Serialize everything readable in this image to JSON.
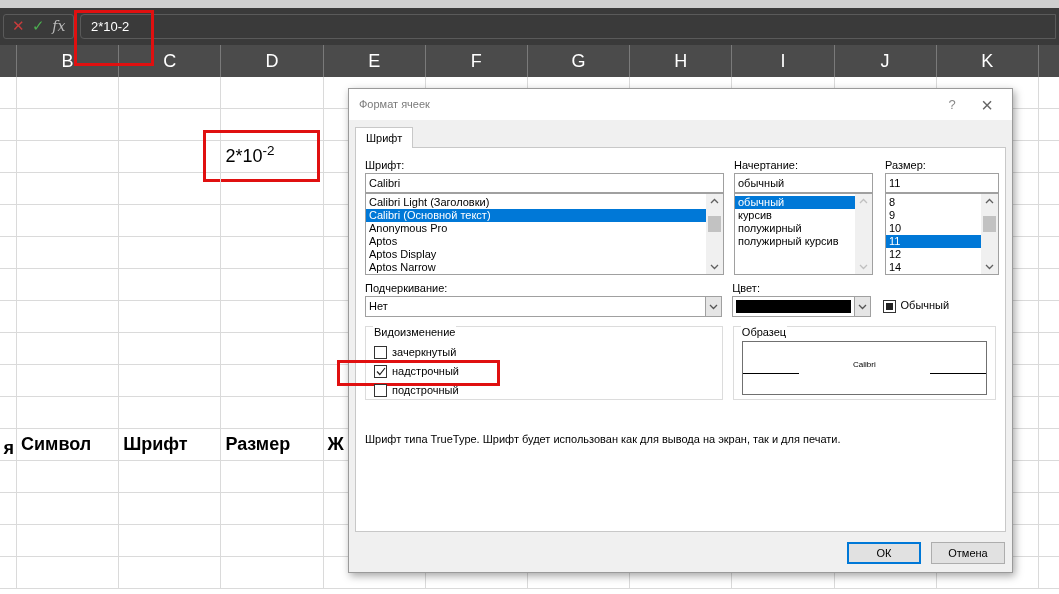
{
  "formula_bar": {
    "cancel": "✕",
    "enter": "✓",
    "function": "fx",
    "value": "2*10-2",
    "highlighted": true
  },
  "sheet": {
    "columns": [
      "B",
      "C",
      "D",
      "E",
      "F",
      "G",
      "H",
      "I",
      "J",
      "K"
    ],
    "value_cell": {
      "text": "2*10$^{-2}$",
      "highlighted": true
    },
    "header_row": [
      "я",
      "Символ",
      "Шрифт",
      "Размер",
      "Ж"
    ]
  },
  "dialog": {
    "title": "Формат ячеек",
    "help": "?",
    "close": "×",
    "tabs": [
      {
        "label": "Шрифт",
        "selected": true
      }
    ],
    "font": {
      "label": "Шрифт:",
      "value": "Calibri",
      "items": [
        {
          "label": "Calibri Light (Заголовки)",
          "selected": false
        },
        {
          "label": "Calibri (Основной текст)",
          "selected": true
        },
        {
          "label": "Anonymous Pro",
          "selected": false
        },
        {
          "label": "Aptos",
          "selected": false
        },
        {
          "label": "Aptos Display",
          "selected": false
        },
        {
          "label": "Aptos Narrow",
          "selected": false
        }
      ]
    },
    "style": {
      "label": "Начертание:",
      "value": "обычный",
      "items": [
        {
          "label": "обычный",
          "selected": true
        },
        {
          "label": "курсив",
          "selected": false
        },
        {
          "label": "полужирный",
          "selected": false
        },
        {
          "label": "полужирный курсив",
          "selected": false
        }
      ]
    },
    "size": {
      "label": "Размер:",
      "value": "11",
      "items": [
        {
          "label": "8",
          "selected": false
        },
        {
          "label": "9",
          "selected": false
        },
        {
          "label": "10",
          "selected": false
        },
        {
          "label": "11",
          "selected": true
        },
        {
          "label": "12",
          "selected": false
        },
        {
          "label": "14",
          "selected": false
        }
      ]
    },
    "underline": {
      "label": "Подчеркивание:",
      "value": "Нет"
    },
    "color": {
      "label": "Цвет:",
      "auto": {
        "label": "Обычный",
        "checked": true
      }
    },
    "effects": {
      "title": "Видоизменение",
      "items": [
        {
          "label": "зачеркнутый",
          "checked": false,
          "highlighted": false
        },
        {
          "label": "надстрочный",
          "checked": true,
          "highlighted": true
        },
        {
          "label": "подстрочный",
          "checked": false,
          "highlighted": false
        }
      ]
    },
    "preview": {
      "title": "Образец",
      "sample": "Calibri"
    },
    "description": "Шрифт типа TrueType. Шрифт будет использован как для вывода на экран, так и для печати.",
    "buttons": [
      {
        "label": "ОК",
        "default": true
      },
      {
        "label": "Отмена",
        "default": false
      }
    ]
  }
}
